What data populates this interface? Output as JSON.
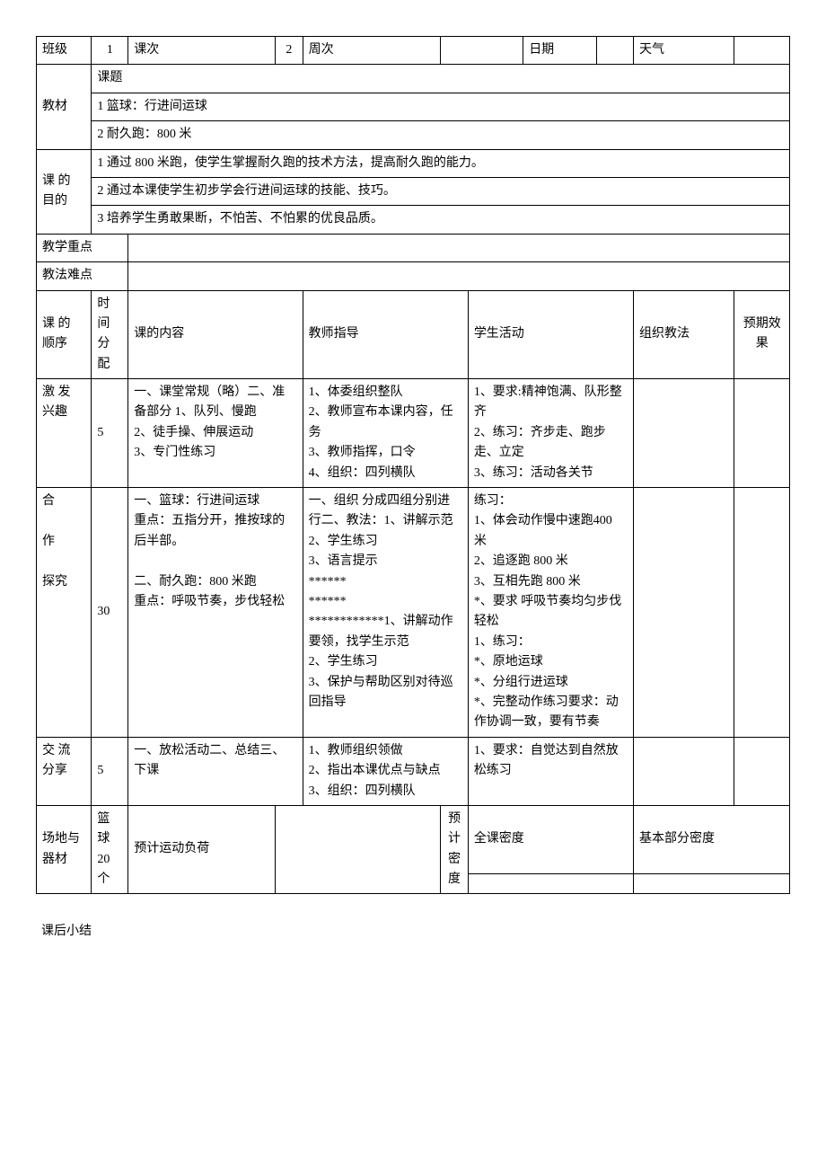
{
  "header": {
    "class_label": "班级",
    "class_value": "1",
    "lesson_no_label": "课次",
    "lesson_no_value": "2",
    "week_label": "周次",
    "week_value": "",
    "date_label": "日期",
    "date_value": "",
    "weather_label": "天气",
    "weather_value": ""
  },
  "material": {
    "label": "教材",
    "topic_label": "课题",
    "line1": "1 篮球：行进间运球",
    "line2": "2 耐久跑：800 米"
  },
  "purpose": {
    "label": "课 的 目的",
    "line1": "1 通过 800 米跑，使学生掌握耐久跑的技术方法，提高耐久跑的能力。",
    "line2": "2 通过本课使学生初步学会行进间运球的技能、技巧。",
    "line3": "3 培养学生勇敢果断，不怕苦、不怕累的优良品质。"
  },
  "keypoint": {
    "label": "教学重点",
    "value": ""
  },
  "difficulty": {
    "label": "教法难点",
    "value": ""
  },
  "cols": {
    "seq": "课 的 顺序",
    "time": "时间分配",
    "content": "课的内容",
    "teacher": "教师指导",
    "student": "学生活动",
    "org": "组织教法",
    "expect": "预期效果"
  },
  "rows": [
    {
      "seq": "激 发 兴趣",
      "time": "5",
      "content": "一、课堂常规（略）二、准备部分 1、队列、慢跑\n2、徒手操、伸展运动\n3、专门性练习",
      "teacher": "1、体委组织整队\n2、教师宣布本课内容，任务\n3、教师指挥，口令\n4、组织：四列横队",
      "student": "1、要求:精神饱满、队形整齐\n2、练习：齐步走、跑步走、立定\n3、练习：活动各关节",
      "org": "",
      "expect": ""
    },
    {
      "seq": "合\n\n作\n\n探究",
      "time": "30",
      "content": "一、篮球：行进间运球\n重点：五指分开，推按球的后半部。\n\n二、耐久跑：800 米跑\n重点：呼吸节奏，步伐轻松",
      "teacher": "一、组织 分成四组分别进行二、教法：1、讲解示范 2、学生练习\n3、语言提示\n******\n******\n************1、讲解动作要领，找学生示范\n2、学生练习\n3、保护与帮助区别对待巡回指导",
      "student": "练习：\n1、体会动作慢中速跑400 米\n2、追逐跑 800 米\n3、互相先跑 800 米\n*、要求 呼吸节奏均匀步伐轻松\n1、练习：\n*、原地运球\n*、分组行进运球\n*、完整动作练习要求：动作协调一致，要有节奏",
      "org": "",
      "expect": ""
    },
    {
      "seq": "交 流 分享",
      "time": "5",
      "content": "一、放松活动二、总结三、下课",
      "teacher": "1、教师组织领做\n2、指出本课优点与缺点\n3、组织：四列横队",
      "student": "1、要求：自觉达到自然放松练习",
      "org": "",
      "expect": ""
    }
  ],
  "bottom": {
    "field_label": "场地与器材",
    "field_value": "篮球20 个",
    "load_label": "预计运动负荷",
    "load_value": "",
    "density_label": "预计密度",
    "full_density_label": "全课密度",
    "full_density_value": "",
    "part_density_label": "基本部分密度",
    "part_density_value": ""
  },
  "footnote": "课后小结"
}
